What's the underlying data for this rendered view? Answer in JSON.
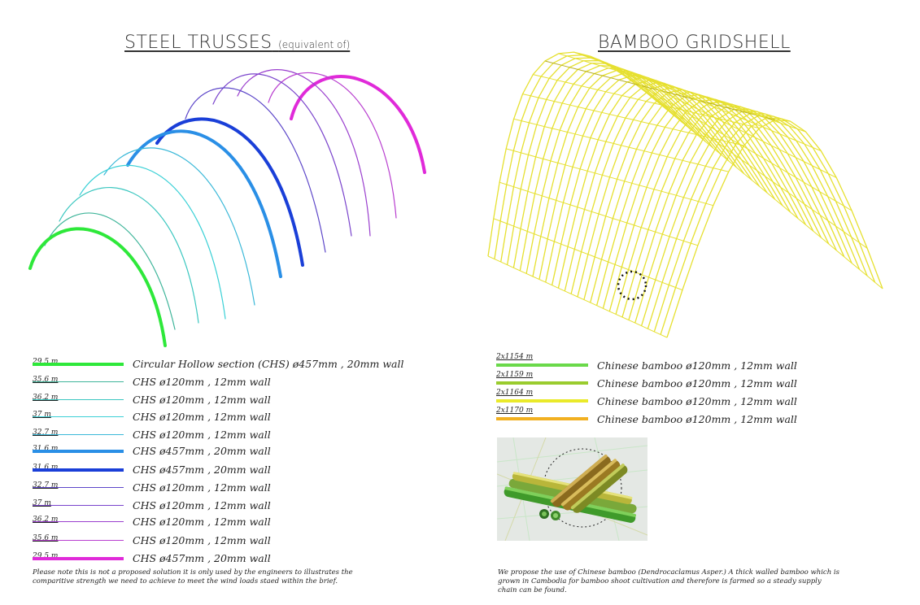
{
  "left_panel": {
    "title_main": "STEEL TRUSSES",
    "title_sub": "(equivalent of)",
    "legend": [
      {
        "length": "29,5 m",
        "desc": "Circular Hollow section (CHS) ø457mm , 20mm wall",
        "color": "#2ee83a",
        "weight": "heavy"
      },
      {
        "length": "35,6 m",
        "desc": "CHS ø120mm , 12mm wall",
        "color": "#3fb59a",
        "weight": "light"
      },
      {
        "length": "36,2 m",
        "desc": "CHS ø120mm , 12mm wall",
        "color": "#3cc7c0",
        "weight": "light"
      },
      {
        "length": "37 m",
        "desc": "CHS ø120mm , 12mm wall",
        "color": "#3ad0d6",
        "weight": "light"
      },
      {
        "length": "32,7 m",
        "desc": "CHS ø120mm , 12mm wall",
        "color": "#3ab8d8",
        "weight": "light"
      },
      {
        "length": "31,6 m",
        "desc": "CHS ø457mm , 20mm wall",
        "color": "#2a8fe6",
        "weight": "heavy"
      },
      {
        "length": "31,6 m",
        "desc": "CHS ø457mm , 20mm wall",
        "color": "#1a3fd8",
        "weight": "heavy"
      },
      {
        "length": "32,7 m",
        "desc": "CHS ø120mm , 12mm wall",
        "color": "#5d47c9",
        "weight": "light"
      },
      {
        "length": "37 m",
        "desc": "CHS ø120mm , 12mm wall",
        "color": "#7a44cc",
        "weight": "light"
      },
      {
        "length": "36,2 m",
        "desc": "CHS ø120mm , 12mm wall",
        "color": "#9a3fce",
        "weight": "light"
      },
      {
        "length": "35,6 m",
        "desc": "CHS ø120mm , 12mm wall",
        "color": "#b83ecf",
        "weight": "light"
      },
      {
        "length": "29,5 m",
        "desc": "CHS ø457mm , 20mm wall",
        "color": "#e02ad9",
        "weight": "heavy"
      }
    ],
    "note": "Please note this is not a proposed solution it is only used by the engineers to illustrates the comparitive strength we need to achieve to meet the wind loads staed within the brief."
  },
  "right_panel": {
    "title_main": "BAMBOO GRIDSHELL",
    "legend": [
      {
        "length": "2x1154 m",
        "desc": "Chinese bamboo ø120mm , 12mm wall",
        "color": "#6ad94a"
      },
      {
        "length": "2x1159 m",
        "desc": "Chinese bamboo ø120mm , 12mm wall",
        "color": "#9acc2e"
      },
      {
        "length": "2x1164 m",
        "desc": "Chinese bamboo ø120mm , 12mm wall",
        "color": "#eaea2a"
      },
      {
        "length": "2x1170 m",
        "desc": "Chinese bamboo ø120mm , 12mm wall",
        "color": "#f2b020"
      }
    ],
    "note": "We propose the use of Chinese bamboo (Dendrocaclamus Asper.) A thick walled bamboo which is grown in Cambodia for bamboo shoot cultivation and therefore is farmed so a steady supply chain can be found."
  },
  "colors": {
    "gridshell": "#e6e030",
    "gridshell_dark": "#b8b020"
  }
}
